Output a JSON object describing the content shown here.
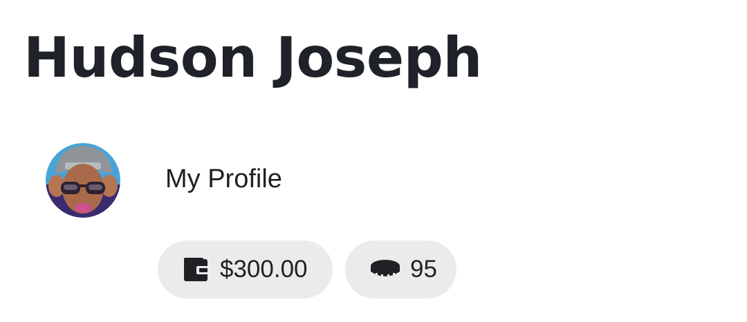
{
  "profile": {
    "name": "Hudson Joseph",
    "link_label": "My Profile",
    "avatar_icon": "user-avatar"
  },
  "balances": {
    "wallet": {
      "icon": "wallet-icon",
      "amount": "$300.00"
    },
    "coins": {
      "icon": "coins-icon",
      "count": "95"
    }
  },
  "colors": {
    "text": "#1f2329",
    "chip_background": "#ebebeb"
  }
}
